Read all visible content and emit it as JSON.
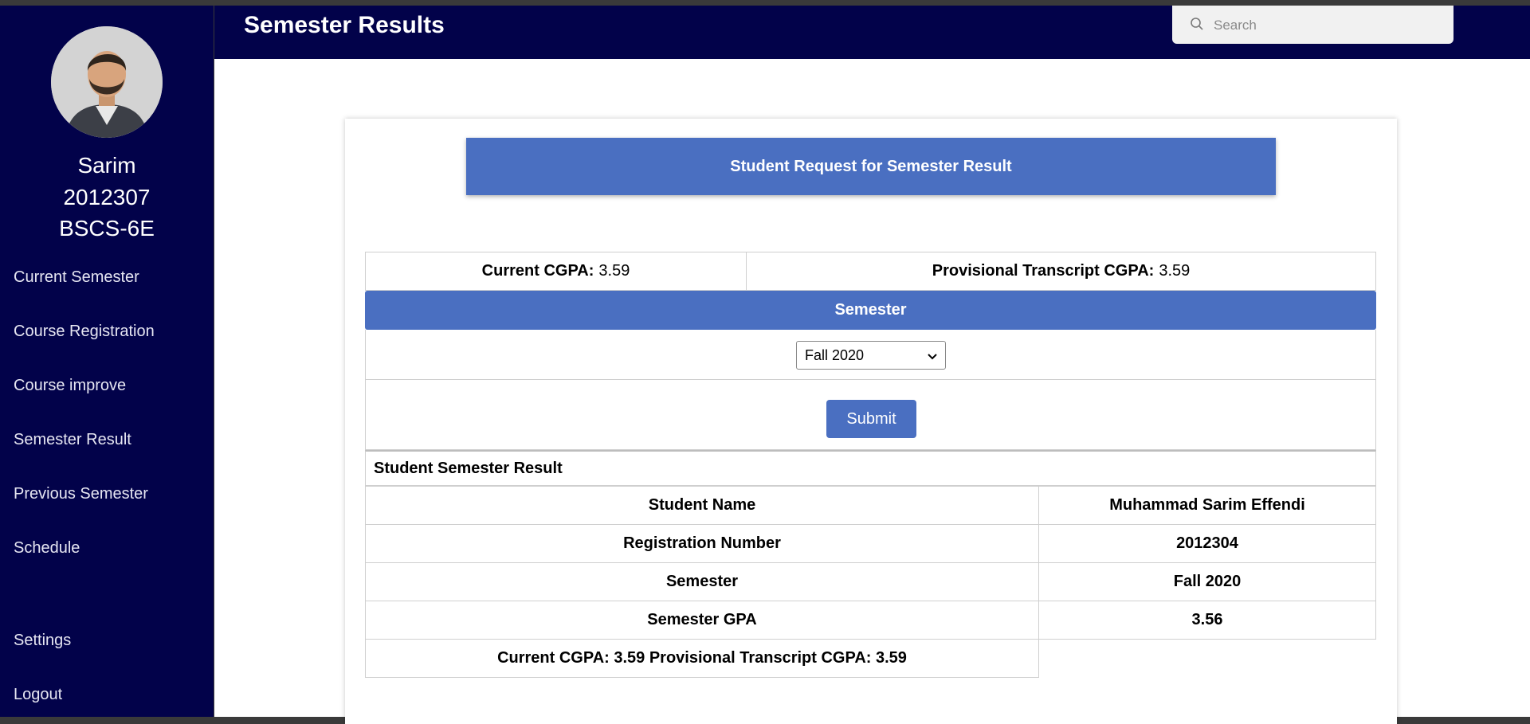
{
  "sidebar": {
    "name": "Sarim",
    "id": "2012307",
    "program": "BSCS-6E",
    "nav": [
      "Current Semester",
      "Course Registration",
      "Course improve",
      "Semester Result",
      "Previous Semester",
      "Schedule"
    ],
    "settings": "Settings",
    "logout": "Logout"
  },
  "header": {
    "title": "Semester Results",
    "search_placeholder": "Search"
  },
  "card": {
    "banner": "Student Request for Semester Result",
    "current_cgpa_label": "Current CGPA:",
    "current_cgpa_value": "3.59",
    "provisional_label": "Provisional Transcript CGPA:",
    "provisional_value": "3.59",
    "semester_header": "Semester",
    "semester_selected": "Fall 2020",
    "submit": "Submit",
    "result_title": "Student Semester Result",
    "rows": [
      {
        "label": "Student Name",
        "value": "Muhammad Sarim Effendi"
      },
      {
        "label": "Registration Number",
        "value": "2012304"
      },
      {
        "label": "Semester",
        "value": "Fall 2020"
      },
      {
        "label": "Semester GPA",
        "value": "3.56"
      }
    ],
    "summary": "Current CGPA: 3.59 Provisional Transcript CGPA: 3.59"
  },
  "colors": {
    "sidebar_bg": "#02024a",
    "accent": "#4a6fc1"
  }
}
